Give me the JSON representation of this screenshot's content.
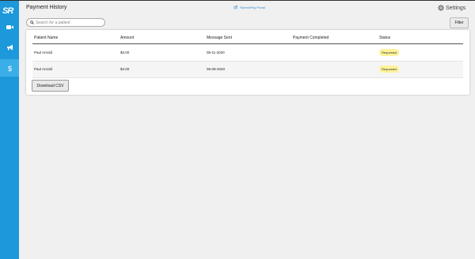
{
  "app": {
    "logo_text": "SR"
  },
  "header": {
    "title": "Payment History",
    "portal_link": "SwervePay Portal",
    "settings_label": "Settings"
  },
  "sidebar": {
    "items": [
      {
        "name": "video",
        "icon": "video-camera-icon",
        "active": false
      },
      {
        "name": "announcements",
        "icon": "megaphone-icon",
        "active": false
      },
      {
        "name": "payments",
        "icon": "dollar-icon",
        "active": true
      }
    ]
  },
  "search": {
    "placeholder": "Search for a patient",
    "value": ""
  },
  "toolbar": {
    "filter_label": "Filter",
    "download_label": "Download CSV"
  },
  "table": {
    "columns": [
      "Patient Name",
      "Amount",
      "Message Sent",
      "Payment Completed",
      "Status"
    ],
    "rows": [
      {
        "patient": "Paul Arnold",
        "amount": "$3.00",
        "message_sent": "06-11-2020",
        "completed": "",
        "status": "Requested"
      },
      {
        "patient": "Paul Arnold",
        "amount": "$4.00",
        "message_sent": "06-09-2020",
        "completed": "",
        "status": "Requested"
      }
    ]
  },
  "colors": {
    "sidebar": "#1d98da",
    "badge": "#fef39a",
    "link": "#2a8bd6"
  }
}
